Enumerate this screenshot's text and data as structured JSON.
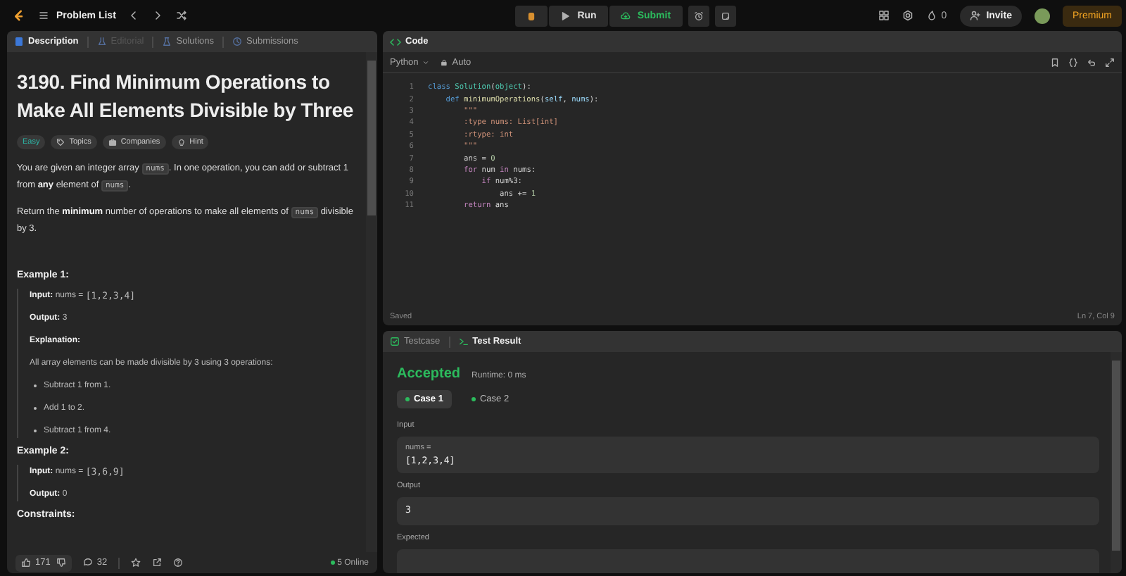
{
  "topbar": {
    "problem_list": "Problem List",
    "run": "Run",
    "submit": "Submit",
    "fire_count": "0",
    "invite": "Invite",
    "premium": "Premium"
  },
  "description_panel": {
    "tabs": [
      {
        "label": "Description",
        "selected": true,
        "disabled": false
      },
      {
        "label": "Editorial",
        "selected": false,
        "disabled": true
      },
      {
        "label": "Solutions",
        "selected": false,
        "disabled": false
      },
      {
        "label": "Submissions",
        "selected": false,
        "disabled": false
      }
    ],
    "title": "3190. Find Minimum Operations to Make All Elements Divisible by Three",
    "difficulty": "Easy",
    "tags": [
      "Topics",
      "Companies",
      "Hint"
    ],
    "paragraphs": [
      [
        {
          "kind": "text",
          "text": "You are given an integer array "
        },
        {
          "kind": "code",
          "text": "nums"
        },
        {
          "kind": "text",
          "text": ". In one operation, you can add or subtract 1 from "
        },
        {
          "kind": "bold",
          "text": "any"
        },
        {
          "kind": "text",
          "text": " element of "
        },
        {
          "kind": "code",
          "text": "nums"
        },
        {
          "kind": "text",
          "text": "."
        }
      ],
      [
        {
          "kind": "text",
          "text": "Return the "
        },
        {
          "kind": "bold",
          "text": "minimum"
        },
        {
          "kind": "text",
          "text": " number of operations to make all elements of "
        },
        {
          "kind": "code",
          "text": "nums"
        },
        {
          "kind": "text",
          "text": " divisible by 3."
        }
      ]
    ],
    "examples": [
      {
        "heading": "Example 1:",
        "lines": [
          {
            "kind": "line",
            "segments": [
              {
                "kind": "bold",
                "text": "Input:"
              },
              {
                "kind": "muted",
                "text": " nums = "
              },
              {
                "kind": "mono",
                "text": "[1,2,3,4]"
              }
            ]
          },
          {
            "kind": "line",
            "segments": [
              {
                "kind": "bold",
                "text": "Output:"
              },
              {
                "kind": "muted",
                "text": " 3"
              }
            ]
          },
          {
            "kind": "line",
            "segments": [
              {
                "kind": "bold",
                "text": "Explanation:"
              }
            ]
          },
          {
            "kind": "line",
            "segments": [
              {
                "kind": "muted",
                "text": "All array elements can be made divisible by 3 using 3 operations:"
              }
            ]
          },
          {
            "kind": "bullet",
            "segments": [
              {
                "kind": "muted",
                "text": "Subtract 1 from 1."
              }
            ]
          },
          {
            "kind": "bullet",
            "segments": [
              {
                "kind": "muted",
                "text": "Add 1 to 2."
              }
            ]
          },
          {
            "kind": "bullet",
            "segments": [
              {
                "kind": "muted",
                "text": "Subtract 1 from 4."
              }
            ]
          }
        ]
      },
      {
        "heading": "Example 2:",
        "lines": [
          {
            "kind": "line",
            "segments": [
              {
                "kind": "bold",
                "text": "Input:"
              },
              {
                "kind": "muted",
                "text": " nums = "
              },
              {
                "kind": "mono",
                "text": "[3,6,9]"
              }
            ]
          },
          {
            "kind": "line",
            "segments": [
              {
                "kind": "bold",
                "text": "Output:"
              },
              {
                "kind": "muted",
                "text": " 0"
              }
            ]
          }
        ]
      }
    ],
    "constraints_heading": "Constraints:",
    "footer": {
      "likes": "171",
      "comments": "32",
      "online": "5 Online"
    }
  },
  "code_panel": {
    "title": "Code",
    "language": "Python",
    "mode": "Auto",
    "lines": [
      {
        "number": "1",
        "tokens": [
          {
            "kind": "kw",
            "text": "class "
          },
          {
            "kind": "cls",
            "text": "Solution"
          },
          {
            "kind": "plain",
            "text": "("
          },
          {
            "kind": "cls",
            "text": "object"
          },
          {
            "kind": "plain",
            "text": "):"
          }
        ]
      },
      {
        "number": "2",
        "tokens": [
          {
            "kind": "kw",
            "text": "    def "
          },
          {
            "kind": "fn",
            "text": "minimumOperations"
          },
          {
            "kind": "plain",
            "text": "("
          },
          {
            "kind": "param",
            "text": "self"
          },
          {
            "kind": "plain",
            "text": ", "
          },
          {
            "kind": "param",
            "text": "nums"
          },
          {
            "kind": "plain",
            "text": "):"
          }
        ]
      },
      {
        "number": "3",
        "tokens": [
          {
            "kind": "str",
            "text": "        \"\"\""
          }
        ]
      },
      {
        "number": "4",
        "tokens": [
          {
            "kind": "str",
            "text": "        :type nums: List[int]"
          }
        ]
      },
      {
        "number": "5",
        "tokens": [
          {
            "kind": "str",
            "text": "        :rtype: int"
          }
        ]
      },
      {
        "number": "6",
        "tokens": [
          {
            "kind": "str",
            "text": "        \"\"\""
          }
        ]
      },
      {
        "number": "7",
        "tokens": [
          {
            "kind": "plain",
            "text": "        ans = "
          },
          {
            "kind": "num",
            "text": "0"
          }
        ]
      },
      {
        "number": "8",
        "tokens": [
          {
            "kind": "ctl",
            "text": "        for"
          },
          {
            "kind": "plain",
            "text": " num "
          },
          {
            "kind": "ctl",
            "text": "in"
          },
          {
            "kind": "plain",
            "text": " nums:"
          }
        ]
      },
      {
        "number": "9",
        "tokens": [
          {
            "kind": "ctl",
            "text": "            if"
          },
          {
            "kind": "plain",
            "text": " num%3:"
          }
        ]
      },
      {
        "number": "10",
        "tokens": [
          {
            "kind": "plain",
            "text": "                ans += "
          },
          {
            "kind": "num",
            "text": "1"
          }
        ]
      },
      {
        "number": "11",
        "tokens": [
          {
            "kind": "ctl",
            "text": "        return"
          },
          {
            "kind": "plain",
            "text": " ans"
          }
        ]
      }
    ],
    "status": "Saved",
    "cursor": "Ln 7, Col 9"
  },
  "test_panel": {
    "tabs": [
      {
        "label": "Testcase",
        "selected": false
      },
      {
        "label": "Test Result",
        "selected": true
      }
    ],
    "verdict": "Accepted",
    "runtime": "Runtime: 0 ms",
    "cases": [
      {
        "label": "Case 1",
        "selected": true
      },
      {
        "label": "Case 2",
        "selected": false
      }
    ],
    "sections": [
      {
        "label": "Input",
        "var": "nums =",
        "value": "[1,2,3,4]"
      },
      {
        "label": "Output",
        "value": "3"
      },
      {
        "label": "Expected"
      }
    ]
  }
}
